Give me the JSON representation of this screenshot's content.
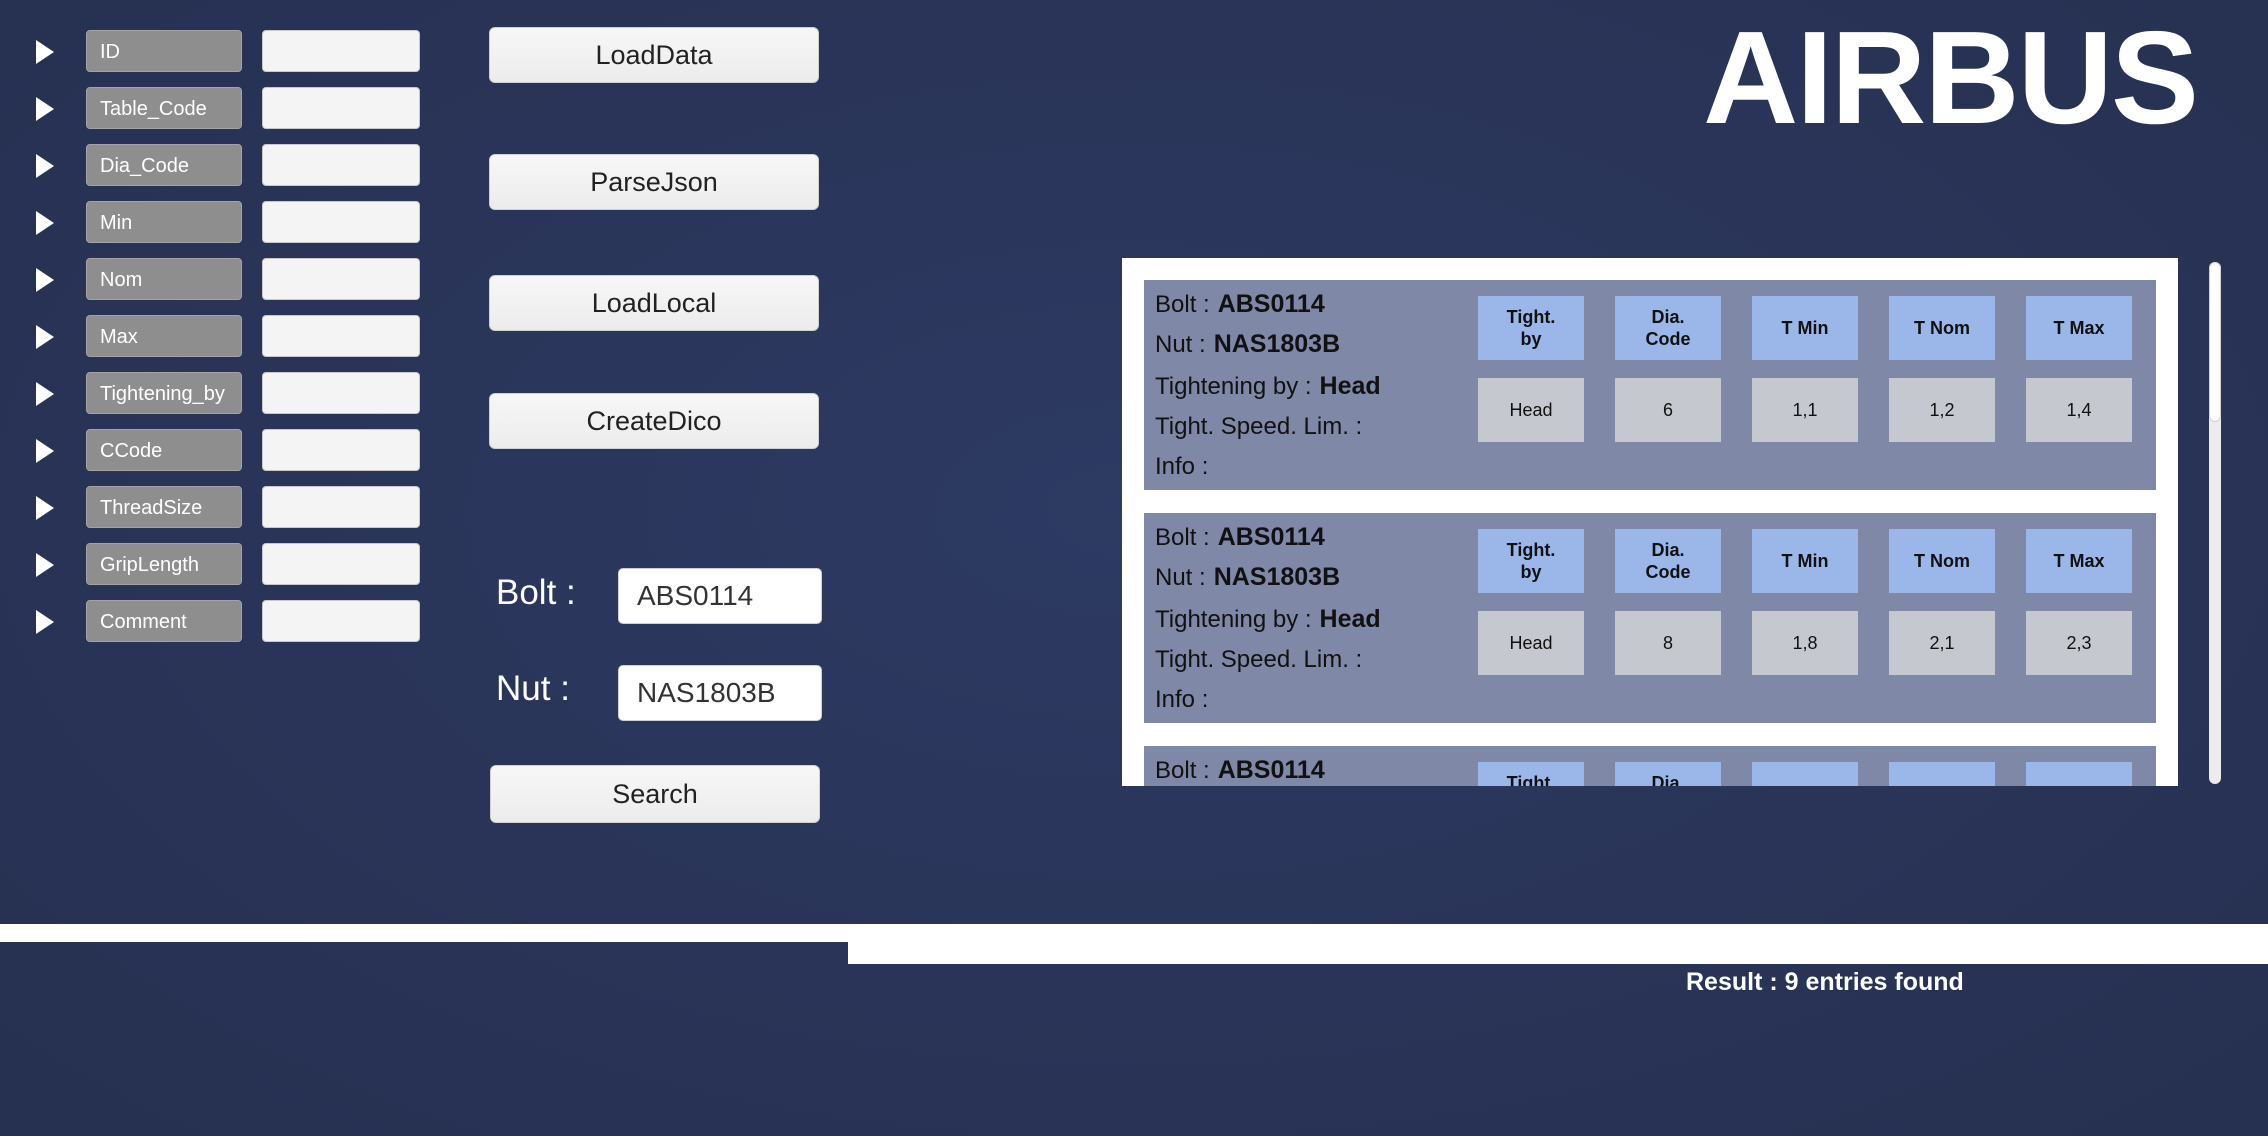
{
  "fields": [
    {
      "label": "ID",
      "value": ""
    },
    {
      "label": "Table_Code",
      "value": ""
    },
    {
      "label": "Dia_Code",
      "value": ""
    },
    {
      "label": "Min",
      "value": ""
    },
    {
      "label": "Nom",
      "value": ""
    },
    {
      "label": "Max",
      "value": ""
    },
    {
      "label": "Tightening_by",
      "value": ""
    },
    {
      "label": "CCode",
      "value": ""
    },
    {
      "label": "ThreadSize",
      "value": ""
    },
    {
      "label": "GripLength",
      "value": ""
    },
    {
      "label": "Comment",
      "value": ""
    }
  ],
  "actions": {
    "load_data": "LoadData",
    "parse_json": "ParseJson",
    "load_local": "LoadLocal",
    "create_dico": "CreateDico",
    "search": "Search"
  },
  "search": {
    "bolt_label": "Bolt :",
    "bolt_value": "ABS0114",
    "nut_label": "Nut :",
    "nut_value": "NAS1803B"
  },
  "logo": {
    "text": "AIRBUS"
  },
  "results": {
    "labels": {
      "bolt": "Bolt :",
      "nut": "Nut :",
      "tightening_by": "Tightening by :",
      "speed_lim": "Tight. Speed. Lim. :",
      "info": "Info :"
    },
    "headers": [
      "Tight.\nby",
      "Dia.\nCode",
      "T Min",
      "T Nom",
      "T Max"
    ],
    "entries": [
      {
        "bolt": "ABS0114",
        "nut": "NAS1803B",
        "tightening_by": "Head",
        "speed_lim": "",
        "info": "",
        "values": [
          "Head",
          "6",
          "1,1",
          "1,2",
          "1,4"
        ]
      },
      {
        "bolt": "ABS0114",
        "nut": "NAS1803B",
        "tightening_by": "Head",
        "speed_lim": "",
        "info": "",
        "values": [
          "Head",
          "8",
          "1,8",
          "2,1",
          "2,3"
        ]
      },
      {
        "bolt": "ABS0114",
        "nut": "",
        "tightening_by": "",
        "speed_lim": "",
        "info": "",
        "values": [
          "",
          "",
          "",
          "",
          ""
        ]
      }
    ]
  },
  "status": {
    "result_text": "Result : 9 entries found",
    "progress": 1.0
  },
  "colors": {
    "background": "#2a355a",
    "card": "#8088a8",
    "header_cell": "#9bb7ea",
    "value_cell": "#c6c8d0"
  }
}
